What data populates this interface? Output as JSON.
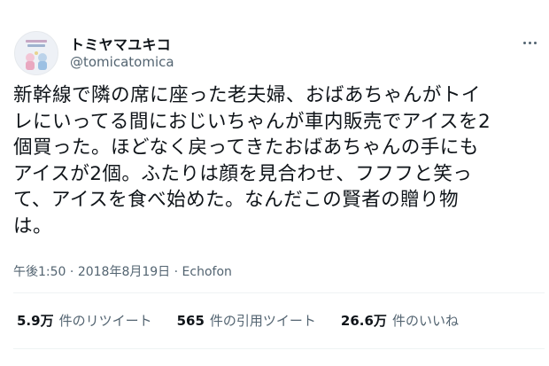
{
  "user": {
    "display_name": "トミヤマユキコ",
    "handle": "@tomicatomica"
  },
  "tweet": {
    "text": "新幹線で隣の席に座った老夫婦、おばあちゃんがトイ\nレにいってる間におじいちゃんが車内販売でアイスを2\n個買った。ほどなく戻ってきたおばあちゃんの手にも\nアイスが2個。ふたりは顔を見合わせ、フフフと笑っ\nて、アイスを食べ始めた。なんだこの賢者の贈り物\nは。"
  },
  "meta": {
    "time": "午後1:50",
    "sep1": " · ",
    "date": "2018年8月19日",
    "sep2": " · ",
    "source": "Echofon"
  },
  "stats": {
    "retweets_count": "5.9万",
    "retweets_label": "件のリツイート",
    "quotes_count": "565",
    "quotes_label": "件の引用ツイート",
    "likes_count": "26.6万",
    "likes_label": "件のいいね"
  },
  "icons": {
    "more": "more-horizontal-icon",
    "avatar": "avatar-image"
  },
  "colors": {
    "text_primary": "#0f1419",
    "text_secondary": "#536471",
    "divider": "#eff3f4",
    "background": "#ffffff"
  }
}
